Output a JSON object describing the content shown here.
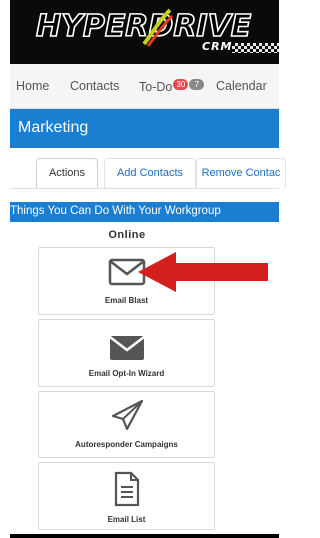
{
  "brand": {
    "logo_text": "HYPERDRIVE",
    "logo_sub": "CRM"
  },
  "nav": {
    "items": [
      {
        "label": "Home"
      },
      {
        "label": "Contacts"
      },
      {
        "label": "To-Do",
        "badge_red": "30",
        "badge_gray": "7"
      },
      {
        "label": "Calendar"
      }
    ]
  },
  "section": {
    "title": "Marketing"
  },
  "tabs": [
    {
      "label": "Actions",
      "active": true
    },
    {
      "label": "Add Contacts",
      "active": false
    },
    {
      "label": "Remove Contac",
      "active": false
    }
  ],
  "workgroup": {
    "heading": "Things You Can Do With Your Workgroup",
    "online_label": "Online"
  },
  "cards": [
    {
      "label": "Email Blast",
      "icon": "envelope-outline-icon"
    },
    {
      "label": "Email Opt-In Wizard",
      "icon": "envelope-filled-icon"
    },
    {
      "label": "Autoresponder Campaigns",
      "icon": "paper-plane-icon"
    },
    {
      "label": "Email List",
      "icon": "document-icon"
    }
  ],
  "colors": {
    "accent_blue": "#1a7fd0",
    "arrow_red": "#d41f1f",
    "badge_red": "#e24a4a"
  }
}
